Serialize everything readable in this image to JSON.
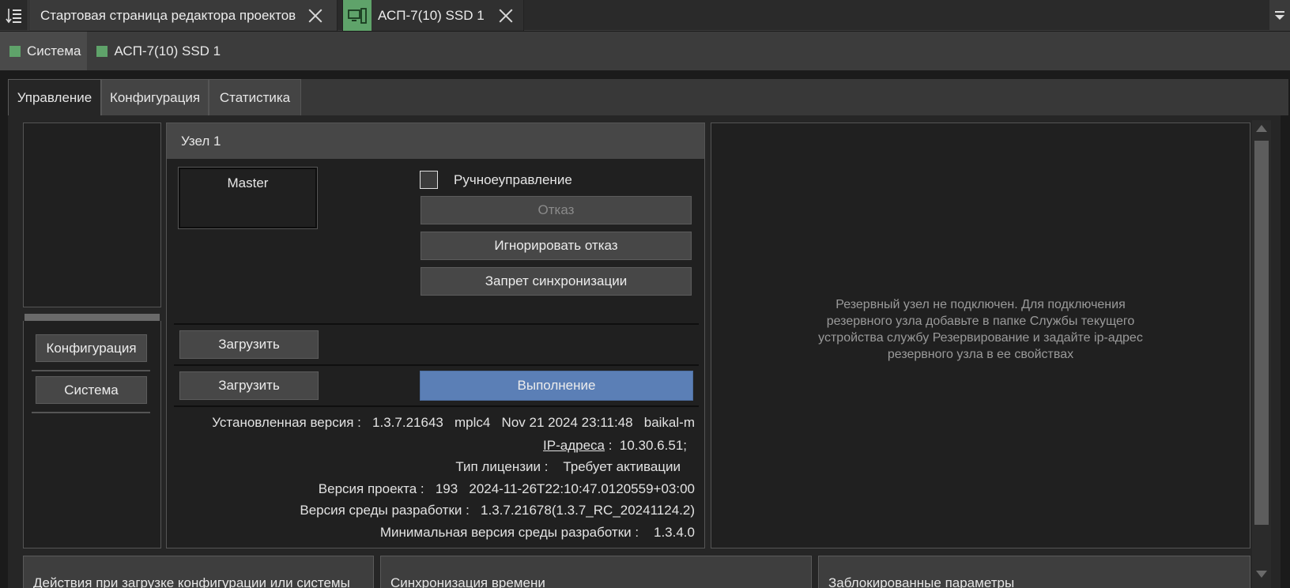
{
  "doc_tabs": [
    {
      "label": "Стартовая страница редактора проектов",
      "icon": "list-sort-icon"
    },
    {
      "label": "АСП-7(10) SSD 1",
      "icon": "device-icon"
    }
  ],
  "breadcrumb": [
    {
      "label": "Система",
      "color": "#5fa36a"
    },
    {
      "label": "АСП-7(10) SSD 1",
      "color": "#5fa36a"
    }
  ],
  "main_tabs": [
    "Управление",
    "Конфигурация",
    "Статистика"
  ],
  "left_nav": {
    "buttons": [
      "Конфигурация",
      "Система"
    ]
  },
  "node": {
    "title": "Узел 1",
    "role": "Master",
    "manual_control_label": "Ручноеуправление",
    "manual_control_checked": false,
    "buttons": {
      "fail": "Отказ",
      "ignore_fail": "Игнорировать отказ",
      "sync_block": "Запрет синхронизации",
      "load1": "Загрузить",
      "load2": "Загрузить",
      "run": "Выполнение"
    },
    "info": {
      "installed_version_label": "Установленная версия :",
      "installed_version_value": "1.3.7.21643   mplc4   Nov 21 2024 23:11:48   baikal-m",
      "ip_label": "IP-адреса",
      "ip_value": ":  10.30.6.51;",
      "license_label": "Тип лицензии :",
      "license_value": "Требует активации",
      "project_version_label": "Версия проекта :",
      "project_version_value": "193   2024-11-26T22:10:47.0120559+03:00",
      "ide_version_label": "Версия среды разработки :",
      "ide_version_value": "1.3.7.21678(1.3.7_RC_20241124.2)",
      "min_ide_version_label": "Минимальная версия среды разработки :",
      "min_ide_version_value": "1.3.4.0"
    }
  },
  "reserve_message": "Резервный узел не подключен. Для подключения резервного узла добавьте в папке Службы текущего устройства службу Резервирование и задайте ip-адрес резервного узла в ее свойствах",
  "bottom_panels": [
    "Действия при загрузке конфигурации или системы",
    "Синхронизация времени",
    "Заблокированные параметры"
  ],
  "colors": {
    "accent": "#5b7fb6",
    "status_green": "#5fa36a"
  }
}
